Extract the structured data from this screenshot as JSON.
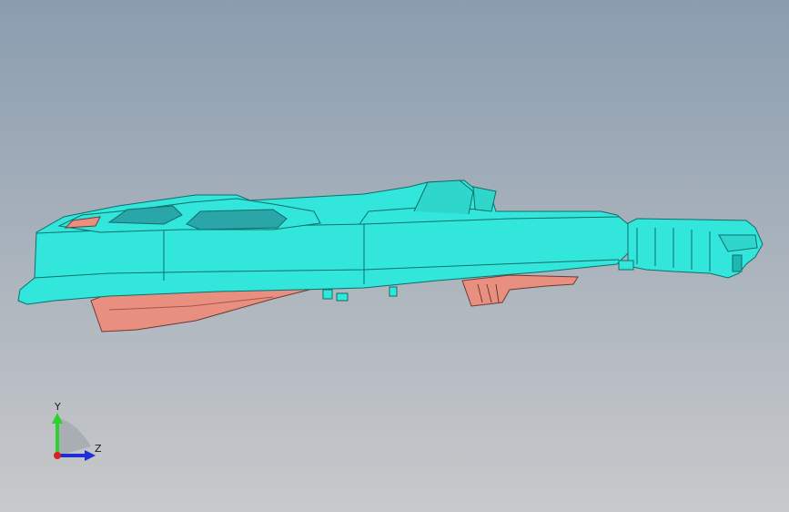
{
  "viewport": {
    "background_top": "#8a9db0",
    "background_bottom": "#c8c9cb"
  },
  "model": {
    "shell_color": "#33e6dc",
    "shell_edge_color": "#0e6e69",
    "lower_part_color": "#e98f80",
    "lower_part_edge": "#6b3b33"
  },
  "triad": {
    "y_label": "Y",
    "z_label": "Z",
    "y_color": "#2fd12f",
    "z_color": "#1f2fd6",
    "x_color": "#e02020"
  }
}
